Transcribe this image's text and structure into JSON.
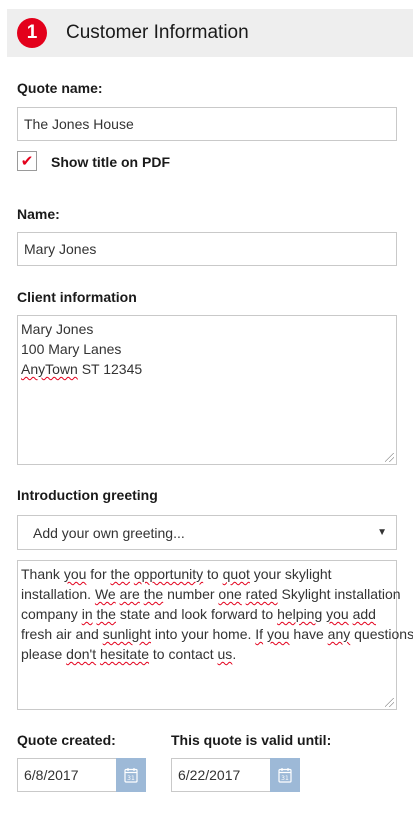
{
  "header": {
    "step_number": "1",
    "title": "Customer Information"
  },
  "quote_name": {
    "label": "Quote name:",
    "value": "The Jones House"
  },
  "show_title": {
    "label": "Show title on PDF",
    "checked": true
  },
  "name": {
    "label": "Name:",
    "value": "Mary Jones"
  },
  "client_info": {
    "label": "Client information",
    "lines": [
      "Mary Jones",
      "100 Mary Lanes",
      "AnyTown ST 12345"
    ]
  },
  "greeting": {
    "label": "Introduction greeting",
    "select_value": "Add your own greeting...",
    "text_lines": [
      "Thank you for the opportunity to quot your skylight",
      "installation. We are the number one rated Skylight installation",
      "company in the state and look forward to helping you add",
      "fresh air and sunlight into your home. If you have any questions",
      "please don't hesitate to contact us."
    ]
  },
  "quote_created": {
    "label": "Quote created:",
    "value": "6/8/2017",
    "calendar_day": "31"
  },
  "valid_until": {
    "label": "This quote is valid until:",
    "value": "6/22/2017",
    "calendar_day": "31"
  },
  "colors": {
    "accent": "#e3001b",
    "calendar_button": "#9db9d7",
    "header_bg": "#eeeeee"
  },
  "icons": {
    "check": "checkmark-icon",
    "dropdown": "caret-down-icon",
    "calendar": "calendar-icon"
  }
}
